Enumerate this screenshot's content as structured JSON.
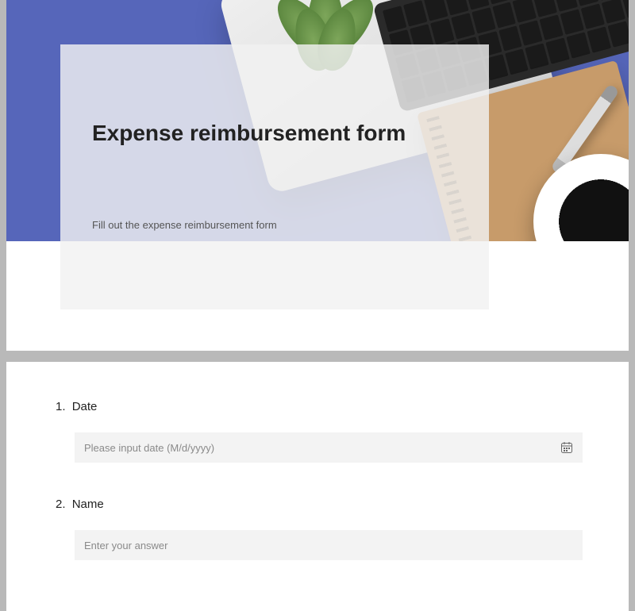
{
  "header": {
    "title": "Expense reimbursement form",
    "subtitle": "Fill out the expense reimbursement form"
  },
  "questions": [
    {
      "number": "1.",
      "label": "Date",
      "placeholder": "Please input date (M/d/yyyy)",
      "has_calendar_icon": true
    },
    {
      "number": "2.",
      "label": "Name",
      "placeholder": "Enter your answer",
      "has_calendar_icon": false
    }
  ]
}
